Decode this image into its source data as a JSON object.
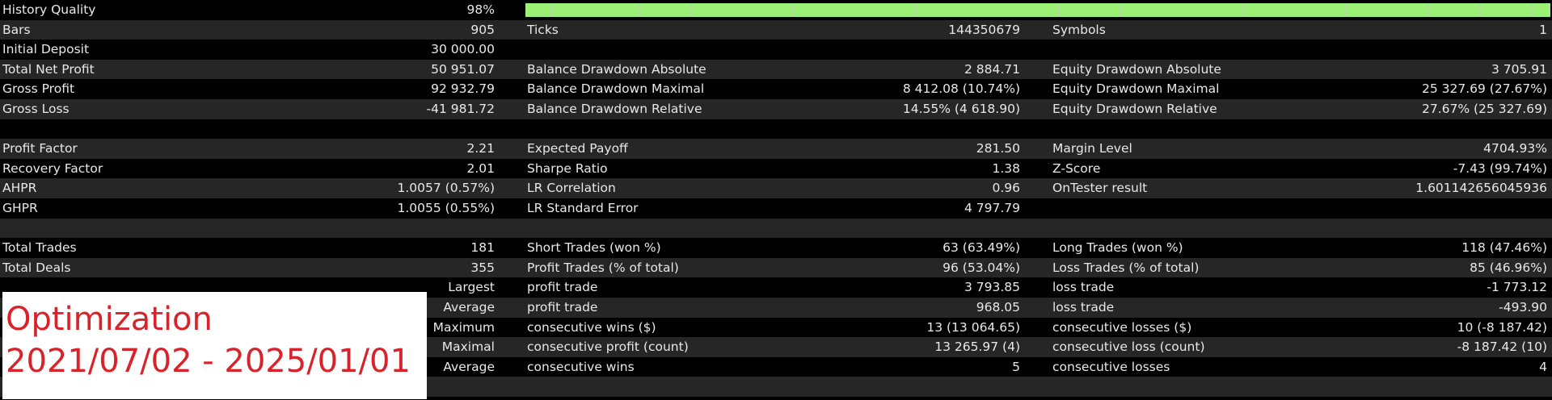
{
  "rows": [
    {
      "l1": "History Quality",
      "v1": "98%",
      "bar": true
    },
    {
      "l1": "Bars",
      "v1": "905",
      "l2": "Ticks",
      "v2": "144350679",
      "l3": "Symbols",
      "v3": "1"
    },
    {
      "l1": "Initial Deposit",
      "v1": "30 000.00"
    },
    {
      "l1": "Total Net Profit",
      "v1": "50 951.07",
      "l2": "Balance Drawdown Absolute",
      "v2": "2 884.71",
      "l3": "Equity Drawdown Absolute",
      "v3": "3 705.91"
    },
    {
      "l1": "Gross Profit",
      "v1": "92 932.79",
      "l2": "Balance Drawdown Maximal",
      "v2": "8 412.08 (10.74%)",
      "l3": "Equity Drawdown Maximal",
      "v3": "25 327.69 (27.67%)"
    },
    {
      "l1": "Gross Loss",
      "v1": "-41 981.72",
      "l2": "Balance Drawdown Relative",
      "v2": "14.55% (4 618.90)",
      "l3": "Equity Drawdown Relative",
      "v3": "27.67% (25 327.69)"
    },
    {},
    {
      "l1": "Profit Factor",
      "v1": "2.21",
      "l2": "Expected Payoff",
      "v2": "281.50",
      "l3": "Margin Level",
      "v3": "4704.93%"
    },
    {
      "l1": "Recovery Factor",
      "v1": "2.01",
      "l2": "Sharpe Ratio",
      "v2": "1.38",
      "l3": "Z-Score",
      "v3": "-7.43 (99.74%)"
    },
    {
      "l1": "AHPR",
      "v1": "1.0057 (0.57%)",
      "l2": "LR Correlation",
      "v2": "0.96",
      "l3": "OnTester result",
      "v3": "1.601142656045936"
    },
    {
      "l1": "GHPR",
      "v1": "1.0055 (0.55%)",
      "l2": "LR Standard Error",
      "v2": "4 797.79"
    },
    {},
    {
      "l1": "Total Trades",
      "v1": "181",
      "l2": "Short Trades (won %)",
      "v2": "63 (63.49%)",
      "l3": "Long Trades (won %)",
      "v3": "118 (47.46%)"
    },
    {
      "l1": "Total Deals",
      "v1": "355",
      "l2": "Profit Trades (% of total)",
      "v2": "96 (53.04%)",
      "l3": "Loss Trades (% of total)",
      "v3": "85 (46.96%)"
    },
    {
      "v1": "Largest",
      "l2": "profit trade",
      "v2": "3 793.85",
      "l3": "loss trade",
      "v3": "-1 773.12"
    },
    {
      "v1": "Average",
      "l2": "profit trade",
      "v2": "968.05",
      "l3": "loss trade",
      "v3": "-493.90"
    },
    {
      "v1": "Maximum",
      "l2": "consecutive wins ($)",
      "v2": "13 (13 064.65)",
      "l3": "consecutive losses ($)",
      "v3": "10 (-8 187.42)"
    },
    {
      "v1": "Maximal",
      "l2": "consecutive profit (count)",
      "v2": "13 265.97 (4)",
      "l3": "consecutive loss (count)",
      "v3": "-8 187.42 (10)"
    },
    {
      "v1": "Average",
      "l2": "consecutive wins",
      "v2": "5",
      "l3": "consecutive losses",
      "v3": "4"
    },
    {}
  ],
  "history_quality_fraction": 0.98,
  "overlay": {
    "line1": "Optimization",
    "line2": "2021/07/02 - 2025/01/01"
  },
  "colors": {
    "quality_bar": "#9cf075",
    "overlay_text": "#d8232a",
    "row_alt": "#262626"
  }
}
